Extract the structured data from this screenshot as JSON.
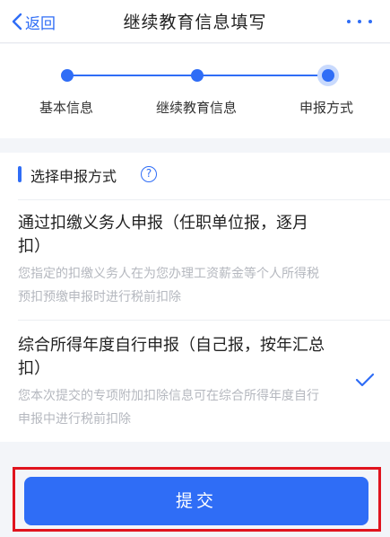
{
  "nav": {
    "back_label": "返回",
    "title": "继续教育信息填写"
  },
  "steps": [
    {
      "label": "基本信息"
    },
    {
      "label": "继续教育信息"
    },
    {
      "label": "申报方式"
    }
  ],
  "section": {
    "title": "选择申报方式",
    "help_icon": "?"
  },
  "options": [
    {
      "title": "通过扣缴义务人申报（任职单位报，逐月扣）",
      "desc": "您指定的扣缴义务人在为您办理工资薪金等个人所得税预扣预缴申报时进行税前扣除",
      "selected": false
    },
    {
      "title": "综合所得年度自行申报（自己报，按年汇总扣）",
      "desc": "您本次提交的专项附加扣除信息可在综合所得年度自行申报中进行税前扣除",
      "selected": true
    }
  ],
  "submit": {
    "label": "提交"
  },
  "colors": {
    "accent": "#2f6df6",
    "highlight_border": "#e0141e"
  }
}
